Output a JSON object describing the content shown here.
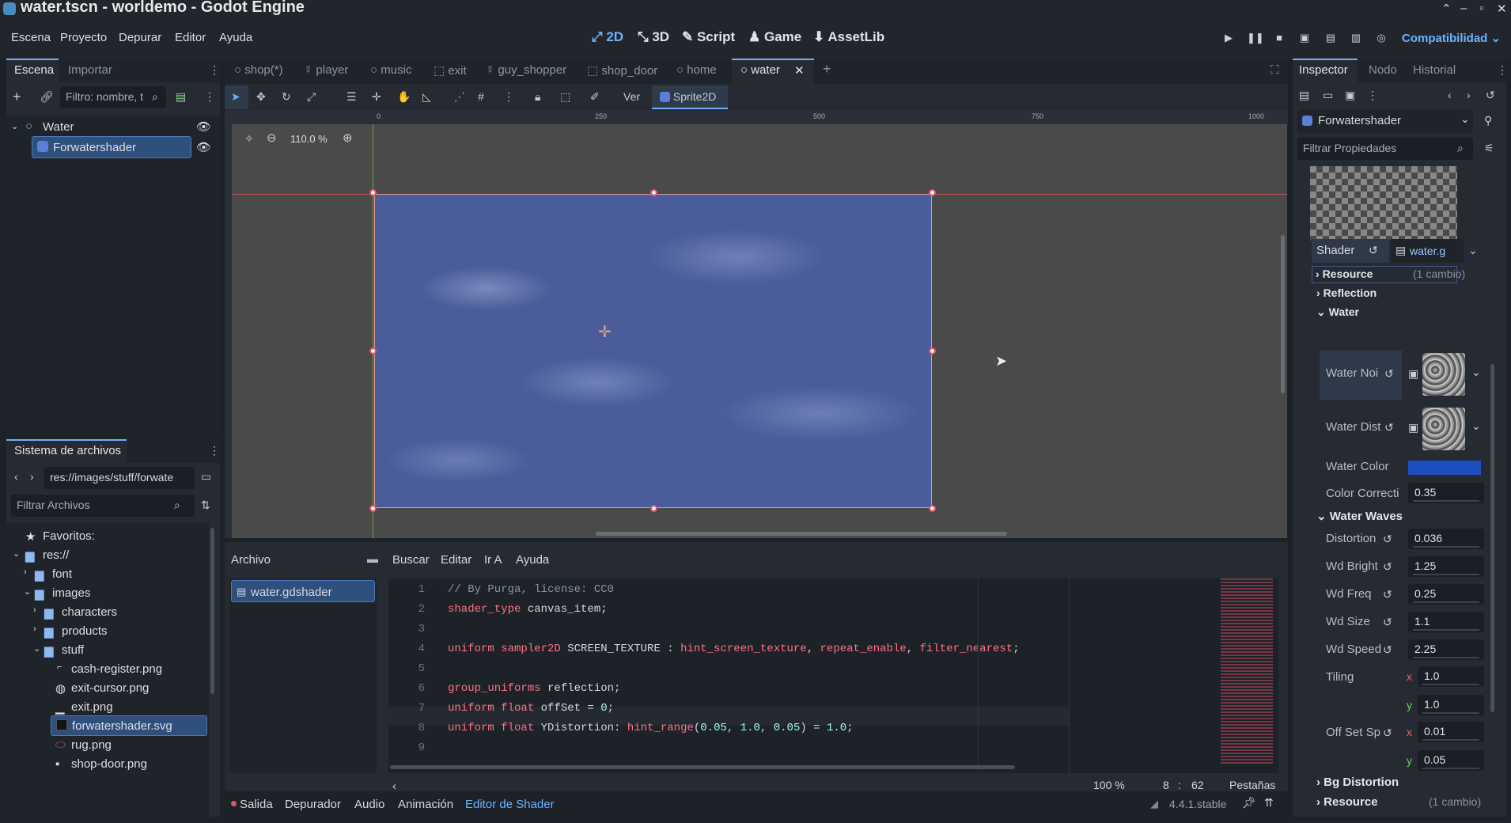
{
  "window": {
    "title": "water.tscn - worldemo - Godot Engine"
  },
  "menus": [
    "Escena",
    "Proyecto",
    "Depurar",
    "Editor",
    "Ayuda"
  ],
  "modes": [
    "2D",
    "3D",
    "Script",
    "Game",
    "AssetLib"
  ],
  "renderer": "Compatibilidad",
  "scene_dock": {
    "tabs": [
      "Escena",
      "Importar"
    ],
    "filter_placeholder": "Filtro: nombre, t",
    "nodes": [
      "Water",
      "Forwatershader"
    ]
  },
  "filesystem": {
    "title": "Sistema de archivos",
    "path": "res://images/stuff/forwate",
    "filter_placeholder": "Filtrar Archivos",
    "items": [
      "Favoritos:",
      "res://",
      "font",
      "images",
      "characters",
      "products",
      "stuff",
      "cash-register.png",
      "exit-cursor.png",
      "exit.png",
      "forwatershader.svg",
      "rug.png",
      "shop-door.png"
    ]
  },
  "editor_tabs": [
    "shop(*)",
    "player",
    "music",
    "exit",
    "guy_shopper",
    "shop_door",
    "home",
    "water"
  ],
  "toolbar": {
    "view": "Ver",
    "node": "Sprite2D"
  },
  "zoom": "110.0 %",
  "ruler": [
    "0",
    "250",
    "500",
    "750",
    "1000"
  ],
  "script_editor": {
    "menus": [
      "Archivo",
      "Buscar",
      "Editar",
      "Ir A",
      "Ayuda"
    ],
    "file": "water.gdshader",
    "zoom": "100 %",
    "cursor_line": "8",
    "cursor_col": "62",
    "indent": "Pestañas",
    "lines": [
      "1",
      "2",
      "3",
      "4",
      "5",
      "6",
      "7",
      "8",
      "9"
    ],
    "code": [
      [
        "// By Purga, license: CC0"
      ],
      [
        "shader_type canvas_item;"
      ],
      [
        ""
      ],
      [
        "uniform sampler2D SCREEN_TEXTURE : hint_screen_texture, repeat_enable, filter_nearest;"
      ],
      [
        ""
      ],
      [
        "group_uniforms reflection;"
      ],
      [
        "uniform float offSet = 0;"
      ],
      [
        "uniform float YDistortion: hint_range(0.05, 1.0, 0.05) = 1.0;"
      ],
      [
        ""
      ]
    ]
  },
  "bottom_tabs": [
    "Salida",
    "Depurador",
    "Audio",
    "Animación",
    "Editor de Shader"
  ],
  "version": "4.4.1.stable",
  "inspector": {
    "tabs": [
      "Inspector",
      "Nodo",
      "Historial"
    ],
    "object": "Forwatershader",
    "filter_placeholder": "Filtrar Propiedades",
    "shader_label": "Shader",
    "shader_file": "water.g",
    "resource": "Resource",
    "changes": "(1 cambio)",
    "reflection": "Reflection",
    "water": "Water",
    "water_noise": "Water Noi",
    "water_dist": "Water Dist",
    "water_color": "Water Color",
    "water_color_hex": "#1c4fbf",
    "color_corr": "Color Correcti",
    "color_corr_val": "0.35",
    "water_waves": "Water Waves",
    "distortion": "Distortion",
    "distortion_val": "0.036",
    "wd_bright": "Wd Bright",
    "wd_bright_val": "1.25",
    "wd_freq": "Wd Freq",
    "wd_freq_val": "0.25",
    "wd_size": "Wd Size",
    "wd_size_val": "1.1",
    "wd_speed": "Wd Speed",
    "wd_speed_val": "2.25",
    "tiling": "Tiling",
    "tiling_x": "1.0",
    "tiling_y": "1.0",
    "offset_sp": "Off Set Sp",
    "offset_x": "0.01",
    "offset_y": "0.05",
    "bg_distortion": "Bg Distortion",
    "resource2": "Resource",
    "changes2": "(1 cambio)"
  }
}
